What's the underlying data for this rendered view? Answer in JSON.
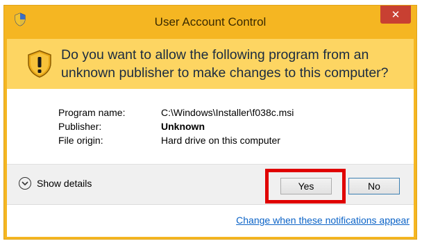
{
  "window": {
    "title": "User Account Control",
    "close_label": "✕"
  },
  "prompt": {
    "question": "Do you want to allow the following program from an unknown publisher to make changes to this computer?"
  },
  "details": {
    "program_name_label": "Program name:",
    "program_name_value": "C:\\Windows\\Installer\\f038c.msi",
    "publisher_label": "Publisher:",
    "publisher_value": "Unknown",
    "file_origin_label": "File origin:",
    "file_origin_value": "Hard drive on this computer"
  },
  "footer": {
    "show_details_label": "Show details",
    "yes_label": "Yes",
    "no_label": "No"
  },
  "link": {
    "change_notifications": "Change when these notifications appear"
  },
  "colors": {
    "titlebar": "#f5b622",
    "prompt_panel": "#fdd562",
    "close_button": "#c84032",
    "highlight": "#e00000",
    "link": "#0b63c7"
  },
  "icons": {
    "title_icon": "uac-shield-icon",
    "prompt_icon": "warning-shield-icon",
    "details_toggle": "chevron-down-circle-icon"
  }
}
